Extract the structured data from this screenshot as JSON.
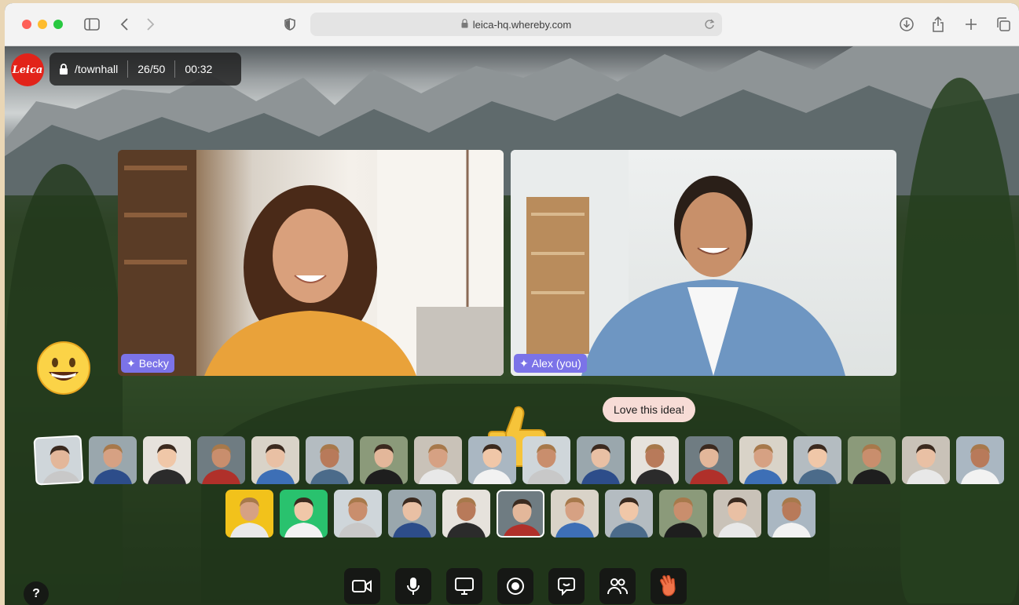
{
  "browser": {
    "url": "leica-hq.whereby.com"
  },
  "room": {
    "brand_logo_text": "Leica",
    "path": "/townhall",
    "participants": "26/50",
    "timer": "00:32"
  },
  "stage": {
    "tiles": [
      {
        "name": "Becky"
      },
      {
        "name": "Alex (you)"
      }
    ],
    "reaction_message": "Love this idea!",
    "emoji_reaction": "grinning-face",
    "floating_reaction": "thumbs-up",
    "help_label": "?"
  },
  "participant_rows": {
    "row1_count": 18,
    "row2_count": 11,
    "colors": {
      "yellow_avatar": "#f2c21b",
      "green_avatar": "#29c26e"
    }
  },
  "toolbar": {
    "buttons": [
      {
        "name": "camera",
        "icon": "camera-icon"
      },
      {
        "name": "microphone",
        "icon": "microphone-icon"
      },
      {
        "name": "screenshare",
        "icon": "monitor-icon"
      },
      {
        "name": "record",
        "icon": "record-icon"
      },
      {
        "name": "chat",
        "icon": "chat-icon"
      },
      {
        "name": "people",
        "icon": "people-icon"
      },
      {
        "name": "raise-hand",
        "icon": "hand-wave-icon"
      }
    ]
  },
  "colors": {
    "brand_red": "#e2231a",
    "name_badge": "#7b73e8",
    "reaction_bubble": "#f7dcd6"
  }
}
